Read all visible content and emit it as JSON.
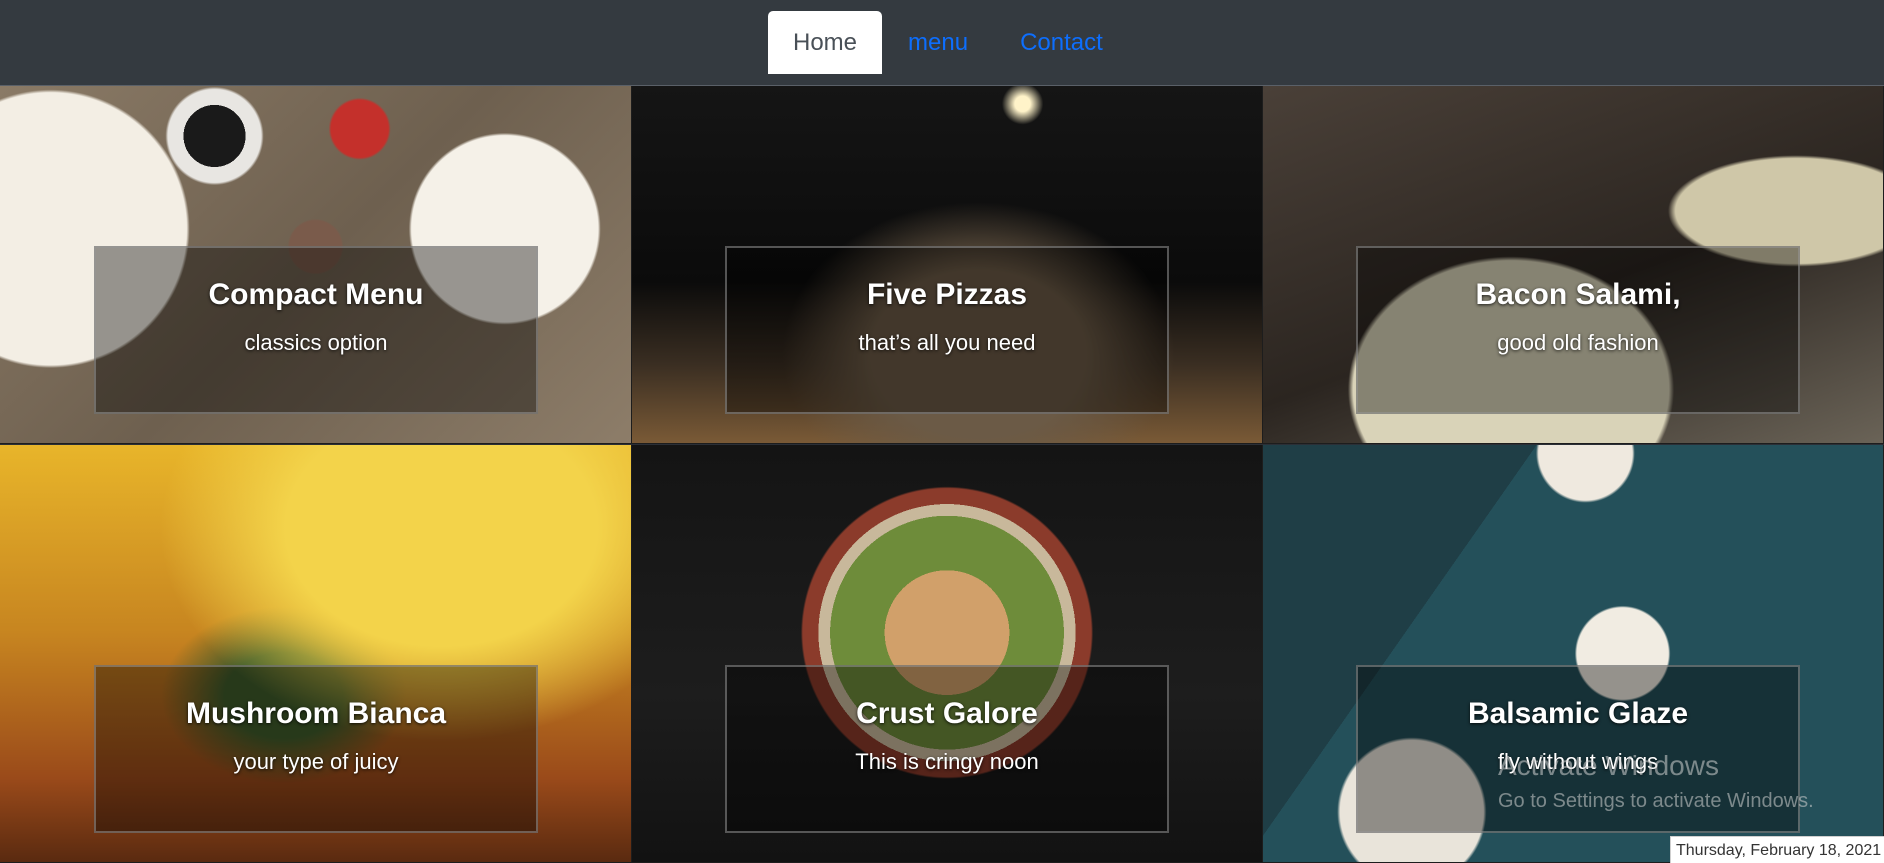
{
  "nav": {
    "items": [
      {
        "label": "Home",
        "active": true
      },
      {
        "label": "menu",
        "active": false
      },
      {
        "label": "Contact",
        "active": false
      }
    ],
    "active_bg": "#ffffff",
    "link_color": "#0d6efd",
    "bar_bg": "#343a40"
  },
  "tiles": [
    {
      "title": "Compact Menu",
      "subtitle": "classics option"
    },
    {
      "title": "Five Pizzas",
      "subtitle": "that’s all you need"
    },
    {
      "title": "Bacon Salami,",
      "subtitle": "good old fashion"
    },
    {
      "title": "Mushroom Bianca",
      "subtitle": "your type of juicy"
    },
    {
      "title": "Crust Galore",
      "subtitle": "This is cringy noon"
    },
    {
      "title": "Balsamic Glaze",
      "subtitle": "fly without wings"
    }
  ],
  "watermark": {
    "title": "Activate Windows",
    "subtitle": "Go to Settings to activate Windows."
  },
  "taskbar": {
    "date": "Thursday, February 18, 2021"
  }
}
